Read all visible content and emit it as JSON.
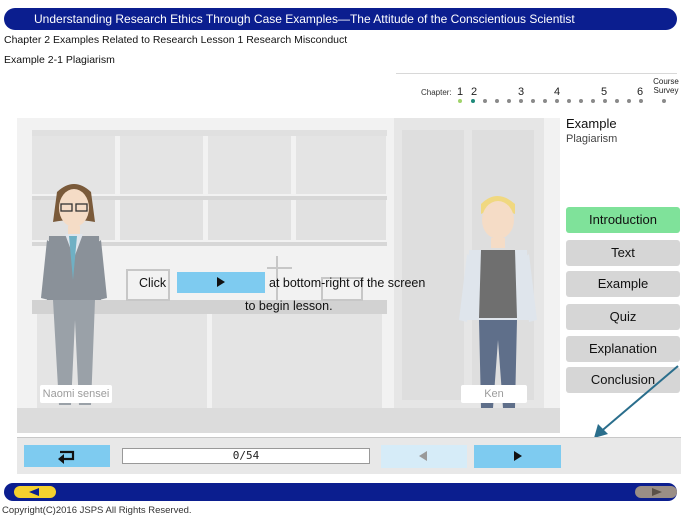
{
  "header": {
    "title": "Understanding Research Ethics Through Case Examples—The Attitude of the Conscientious Scientist",
    "breadcrumb_chapter": "Chapter 2 Examples Related to Research Lesson 1 Research Misconduct",
    "breadcrumb_example": "Example 2-1 Plagiarism"
  },
  "chapter_nav": {
    "label": "Chapter:",
    "chapters": [
      "1",
      "2",
      "3",
      "4",
      "5",
      "6"
    ],
    "course_survey": "Course\nSurvey"
  },
  "scene": {
    "instruction_click": "Click",
    "instruction_rest": "at bottom-right of the screen",
    "instruction_line2": "to begin lesson.",
    "characters": [
      "Naomi sensei",
      "Ken"
    ]
  },
  "sidebar": {
    "title": "Example",
    "subtitle": "Plagiarism",
    "menu": [
      "Introduction",
      "Text",
      "Example",
      "Quiz",
      "Explanation",
      "Conclusion"
    ],
    "active_item": "Introduction"
  },
  "controls": {
    "progress": "0/54"
  },
  "footer": {
    "copyright": "Copyright(C)2016 JSPS All Rights Reserved."
  },
  "colors": {
    "brand_navy": "#0b1e8f",
    "button_blue": "#7ecbf0",
    "active_green": "#7fe29a",
    "menu_gray": "#d6d6d6"
  }
}
